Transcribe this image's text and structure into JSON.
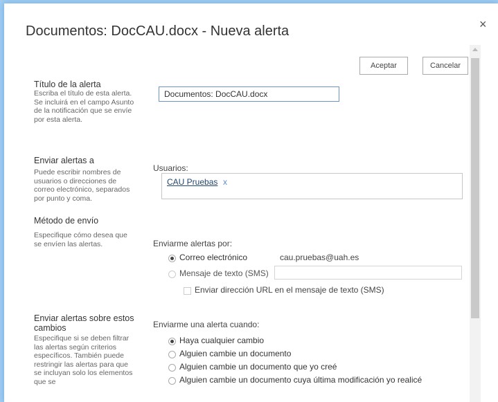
{
  "dialog": {
    "title": "Documentos: DocCAU.docx - Nueva alerta",
    "close_icon": "×",
    "ok_label": "Aceptar",
    "cancel_label": "Cancelar"
  },
  "alert_title": {
    "heading": "Título de la alerta",
    "description": "Escriba el título de esta alerta. Se incluirá en el campo Asunto de la notificación que se envíe por esta alerta.",
    "value": "Documentos: DocCAU.docx"
  },
  "send_to": {
    "heading": "Enviar alertas a",
    "description": "Puede escribir nombres de usuarios o direcciones de correo electrónico, separados por punto y coma.",
    "users_label": "Usuarios:",
    "user_name": "CAU Pruebas",
    "remove_icon": "x"
  },
  "delivery": {
    "heading": "Método de envío",
    "description": "Especifique cómo desea que se envíen las alertas.",
    "label": "Enviarme alertas por:",
    "email_label": "Correo electrónico",
    "email_address": "cau.pruebas@uah.es",
    "sms_label": "Mensaje de texto (SMS)",
    "sms_url_label": "Enviar dirección URL en el mensaje de texto (SMS)",
    "selected": "email"
  },
  "changes": {
    "heading": "Enviar alertas sobre estos cambios",
    "description": "Especifique si se deben filtrar las alertas según criterios específicos. También puede restringir las alertas para que se incluyan solo los elementos que se",
    "label": "Enviarme una alerta cuando:",
    "options": [
      "Haya cualquier cambio",
      "Alguien cambie un documento",
      "Alguien cambie un documento que yo creé",
      "Alguien cambie un documento cuya última modificación yo realicé"
    ],
    "selected_index": 0
  }
}
